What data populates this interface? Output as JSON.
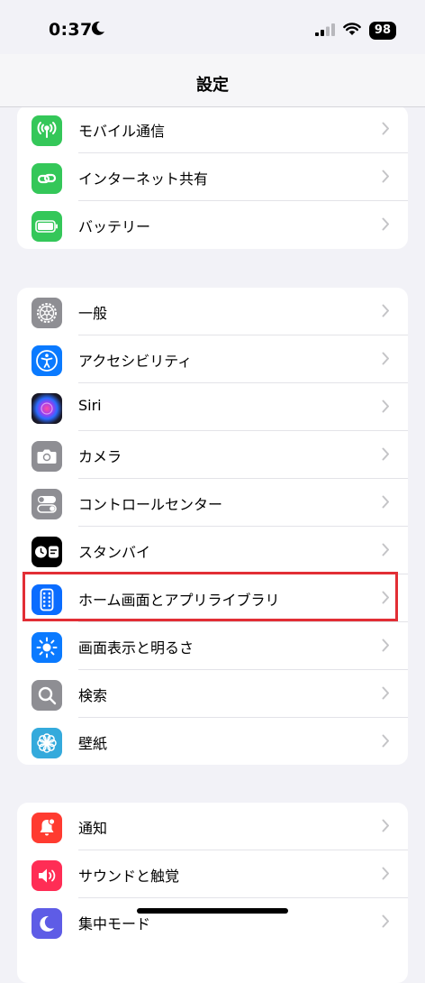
{
  "status": {
    "time": "0:37",
    "battery": "98"
  },
  "header": {
    "title": "設定"
  },
  "group1": [
    {
      "label": "モバイル通信",
      "icon": "cellular-antenna-icon",
      "color": "#34c759"
    },
    {
      "label": "インターネット共有",
      "icon": "chain-link-icon",
      "color": "#34c759"
    },
    {
      "label": "バッテリー",
      "icon": "battery-icon",
      "color": "#34c759"
    }
  ],
  "group2": [
    {
      "label": "一般",
      "icon": "gear-icon",
      "color": "#8e8e93"
    },
    {
      "label": "アクセシビリティ",
      "icon": "accessibility-icon",
      "color": "#0a7aff"
    },
    {
      "label": "Siri",
      "icon": "siri-icon",
      "color": "#1c1c2e"
    },
    {
      "label": "カメラ",
      "icon": "camera-icon",
      "color": "#8e8e93"
    },
    {
      "label": "コントロールセンター",
      "icon": "toggles-icon",
      "color": "#8e8e93"
    },
    {
      "label": "スタンバイ",
      "icon": "standby-icon",
      "color": "#000000"
    },
    {
      "label": "ホーム画面とアプリライブラリ",
      "icon": "home-screen-icon",
      "color": "#0a6cff"
    },
    {
      "label": "画面表示と明るさ",
      "icon": "sun-icon",
      "color": "#0a7aff"
    },
    {
      "label": "検索",
      "icon": "search-icon",
      "color": "#8e8e93"
    },
    {
      "label": "壁紙",
      "icon": "flower-icon",
      "color": "#34aadc"
    }
  ],
  "group3": [
    {
      "label": "通知",
      "icon": "bell-icon",
      "color": "#ff3b30"
    },
    {
      "label": "サウンドと触覚",
      "icon": "speaker-icon",
      "color": "#ff2d55"
    },
    {
      "label": "集中モード",
      "icon": "moon-icon",
      "color": "#5e5ce6"
    }
  ]
}
